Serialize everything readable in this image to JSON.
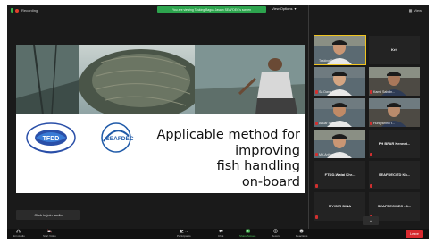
{
  "topbar": {
    "recording_label": "Recording",
    "share_banner": "You are viewing Tasking Bagus Jasam SEAFDEC's screen",
    "view_options_label": "View Options",
    "view_label": "View"
  },
  "slide": {
    "title_lines": [
      "Applicable method for",
      "improving",
      "fish handling",
      "on-board"
    ],
    "logo1_text": "TFDD",
    "logo2_text": "SEAFDEC"
  },
  "join_audio_label": "Click to join audio",
  "gallery": {
    "tiles": [
      {
        "name": "Tasking Bagus J...",
        "kind": "video",
        "active": true
      },
      {
        "name": "Krit",
        "kind": "name"
      },
      {
        "name": "Sa Dang Ch...",
        "kind": "video"
      },
      {
        "name": "Kamil Sabdin...",
        "kind": "video"
      },
      {
        "name": "Anuar Ismail...",
        "kind": "video"
      },
      {
        "name": "Hungrahtho t...",
        "kind": "video"
      },
      {
        "name": "MY-Arthur Ben...",
        "kind": "video"
      },
      {
        "name": "PH BFAR Kennet...",
        "kind": "name"
      },
      {
        "name": "FTDD-Watai Khr...",
        "kind": "name"
      },
      {
        "name": "SEAFDEC/TD Kh...",
        "kind": "name"
      },
      {
        "name": "MY/SITI DINA",
        "kind": "name"
      },
      {
        "name": "SEAFDEC/SEC - 1...",
        "kind": "name"
      }
    ]
  },
  "toolbar": {
    "join_audio": "Join Audio",
    "start_video": "Start Video",
    "participants": "Participants",
    "participants_count": "71",
    "chat": "Chat",
    "share_screen": "Share Screen",
    "record": "Record",
    "reactions": "Reactions",
    "end": "Leave"
  },
  "colors": {
    "banner_green": "#2da44e",
    "end_red": "#d8292f",
    "active_border": "#f0c420"
  }
}
